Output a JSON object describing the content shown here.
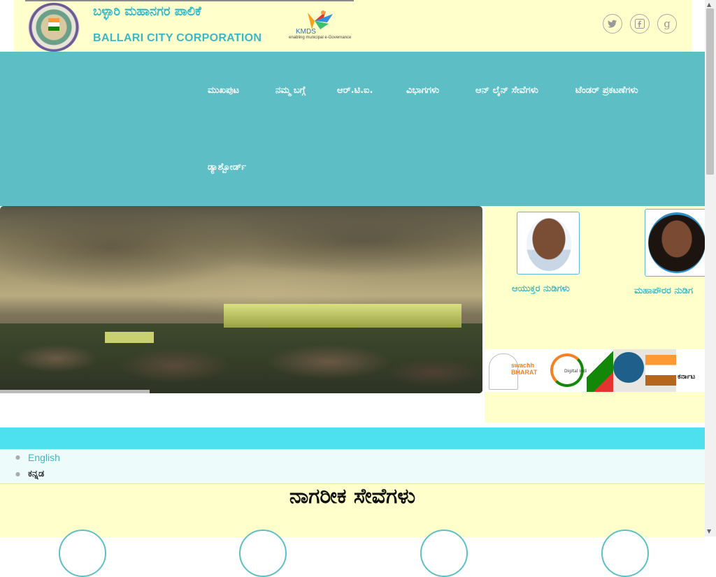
{
  "header": {
    "title_kn": "ಬಳ್ಳಾರಿ ಮಹಾನಗರ ಪಾಲಿಕೆ",
    "title_en": "BALLARI CITY CORPORATION",
    "logo_icon": "city-corporation-seal-icon",
    "partner_logo": {
      "text": "KMDS",
      "tagline": "enabling municipal e-Governance"
    }
  },
  "social": [
    {
      "name": "twitter-icon",
      "glyph": "🐦"
    },
    {
      "name": "facebook-icon",
      "glyph": "f"
    },
    {
      "name": "google-plus-icon",
      "glyph": "g"
    }
  ],
  "nav": {
    "items": [
      {
        "label": "ಮುಖಪುಟ"
      },
      {
        "label": "ನಮ್ಮ ಬಗ್ಗೆ"
      },
      {
        "label": "ಆರ್.ಟಿ.ಐ."
      },
      {
        "label": "ವಿಭಾಗಗಳು"
      },
      {
        "label": "ಆನ್ ಲೈನ್ ಸೇವೆಗಳು"
      },
      {
        "label": "ಟೆಂಡರ್ ಪ್ರಕಟಣೆಗಳು"
      },
      {
        "label": "ಡ್ಯಾಶ್ಬೋರ್ಡ್"
      }
    ]
  },
  "side": {
    "commissioner_label": "ಆಯುಕ್ತರ ನುಡಿಗಳು",
    "mayor_label": "ಮಹಾಪೌರರ ನುಡಿಗ",
    "banners": [
      {
        "name": "swachh-bharat-logo",
        "text": "swachh BHARAT"
      },
      {
        "name": "digital-india-logo",
        "text": "Digital India"
      },
      {
        "name": "government-emblem-logo",
        "text": ""
      },
      {
        "name": "karnataka-logo",
        "text": "ಕರ್ನಾಟ"
      }
    ]
  },
  "languages": [
    {
      "label": "English"
    },
    {
      "label": "ಕನ್ನಡ"
    }
  ],
  "services": {
    "title": "ನಾಗರೀಕ ಸೇವೆಗಳು"
  },
  "colors": {
    "header_bg": "#ffffcc",
    "nav_bg": "#5dbfc5",
    "accent": "#3ab8c6",
    "bar": "#4de0ee"
  }
}
